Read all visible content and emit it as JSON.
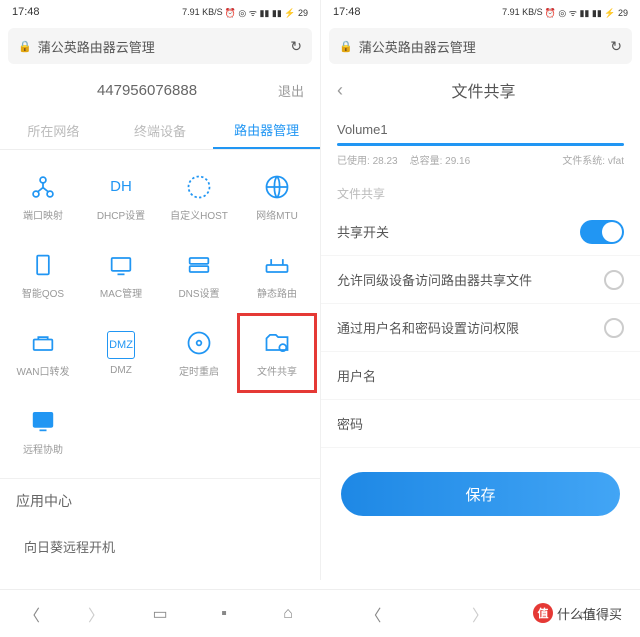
{
  "status": {
    "time": "17:48",
    "net": "7.91 KB/S",
    "icons": "⏰ ◎ ᯤ ▮▮ ▮▮ ⚡ 29"
  },
  "addr": {
    "text": "蒲公英路由器云管理"
  },
  "left": {
    "device_id": "447956076888",
    "exit": "退出",
    "tabs": [
      "所在网络",
      "终端设备",
      "路由器管理"
    ],
    "grid": [
      {
        "label": "端口映射"
      },
      {
        "label": "DHCP设置",
        "txt": "DH"
      },
      {
        "label": "自定义HOST"
      },
      {
        "label": "网络MTU"
      },
      {
        "label": "智能QOS"
      },
      {
        "label": "MAC管理"
      },
      {
        "label": "DNS设置"
      },
      {
        "label": "静态路由"
      },
      {
        "label": "WAN口转发"
      },
      {
        "label": "DMZ",
        "txt": "DMZ"
      },
      {
        "label": "定时重启"
      },
      {
        "label": "文件共享"
      },
      {
        "label": "远程协助"
      }
    ],
    "app_center": "应用中心",
    "app_item": "向日葵远程开机"
  },
  "right": {
    "title": "文件共享",
    "volume": {
      "name": "Volume1",
      "used_label": "已使用:",
      "used": "28.23",
      "total_label": "总容量:",
      "total": "29.16",
      "fs_label": "文件系统:",
      "fs": "vfat"
    },
    "section": "文件共享",
    "rows": {
      "switch": "共享开关",
      "allow": "允许同级设备访问路由器共享文件",
      "auth": "通过用户名和密码设置访问权限",
      "user": "用户名",
      "pass": "密码"
    },
    "save": "保存"
  },
  "watermark": "什么值得买"
}
